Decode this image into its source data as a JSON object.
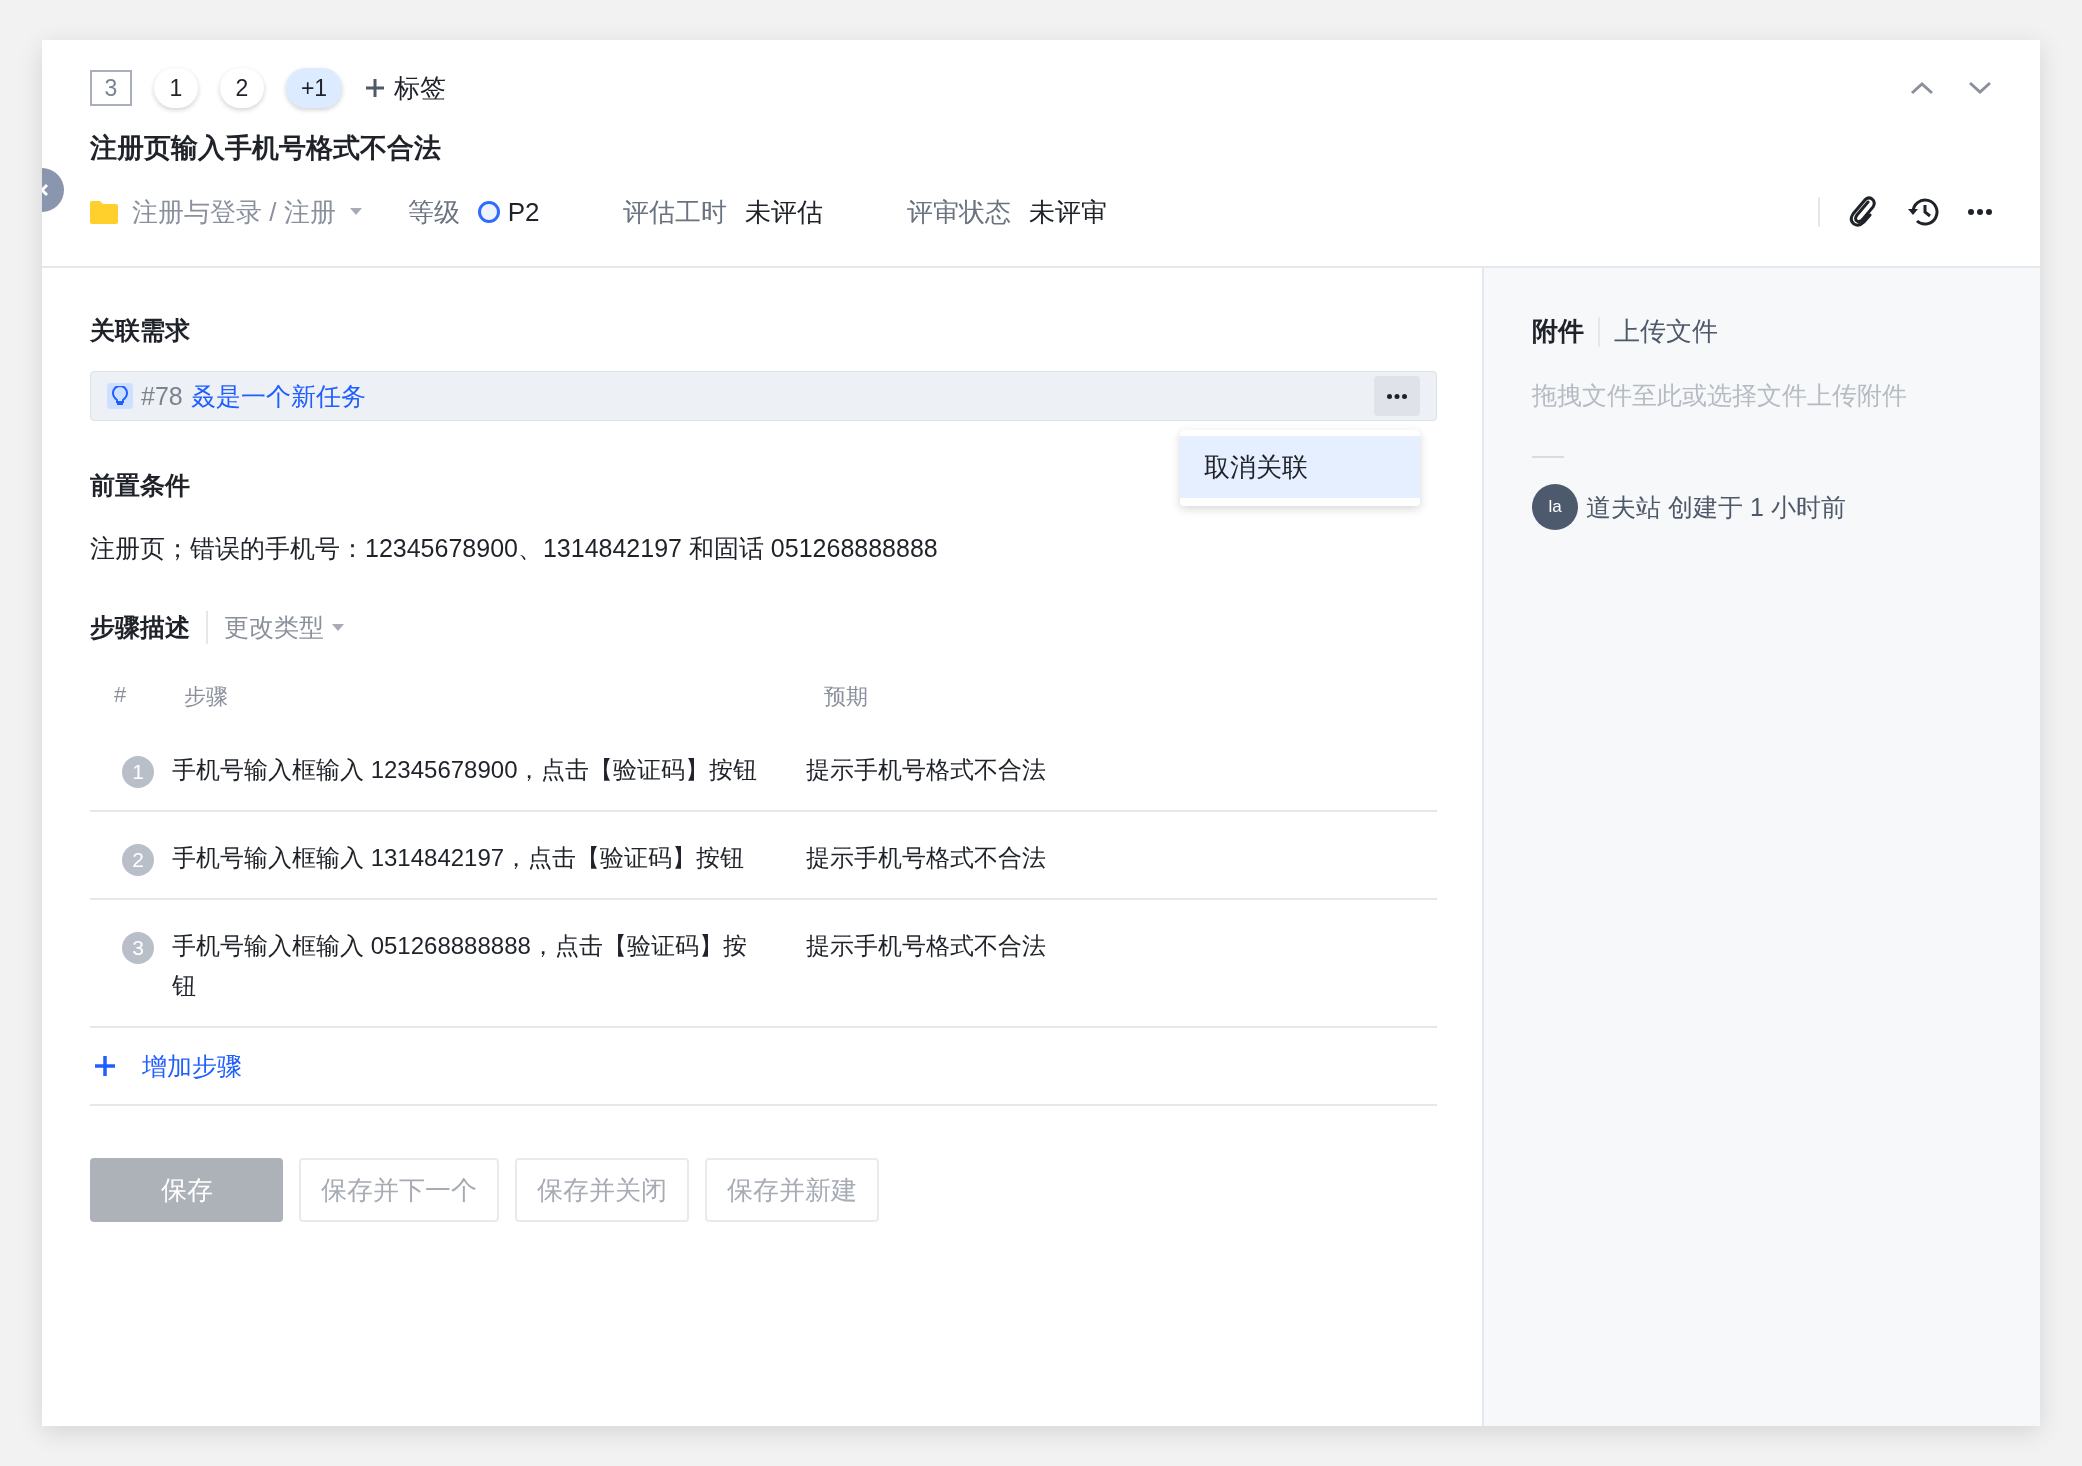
{
  "tag_counter": "3",
  "tags": [
    {
      "label": "1",
      "kind": "number"
    },
    {
      "label": "2",
      "kind": "number"
    },
    {
      "label": "+1",
      "kind": "more"
    }
  ],
  "add_tag": {
    "label": "标签"
  },
  "title": "注册页输入手机号格式不合法",
  "meta": {
    "folder_path": "注册与登录 / 注册",
    "fields": [
      {
        "label": "等级",
        "value": "P2",
        "kind": "priority"
      },
      {
        "label": "评估工时",
        "value": "未评估",
        "kind": "text"
      },
      {
        "label": "评审状态",
        "value": "未评审",
        "kind": "text"
      }
    ]
  },
  "linked_requirement": {
    "heading": "关联需求",
    "id": "#78",
    "name": "叒是一个新任务",
    "menu": [
      {
        "label": "取消关联",
        "selected": true
      }
    ]
  },
  "precondition": {
    "heading": "前置条件",
    "text": "注册页；错误的手机号：12345678900、1314842197 和固话 051268888888"
  },
  "steps": {
    "heading": "步骤描述",
    "change_type": "更改类型",
    "columns": [
      "#",
      "步骤",
      "预期"
    ],
    "rows": [
      {
        "number": "1",
        "step": "手机号输入框输入 12345678900，点击【验证码】按钮",
        "expected": "提示手机号格式不合法"
      },
      {
        "number": "2",
        "step": "手机号输入框输入 1314842197，点击【验证码】按钮",
        "expected": "提示手机号格式不合法"
      },
      {
        "number": "3",
        "step": "手机号输入框输入 051268888888，点击【验证码】按钮",
        "expected": "提示手机号格式不合法"
      }
    ],
    "add_step": "增加步骤"
  },
  "buttons": [
    {
      "label": "保存",
      "kind": "primary",
      "disabled": true
    },
    {
      "label": "保存并下一个",
      "kind": "default",
      "disabled": true
    },
    {
      "label": "保存并关闭",
      "kind": "default",
      "disabled": true
    },
    {
      "label": "保存并新建",
      "kind": "default",
      "disabled": true
    }
  ],
  "side_panel": {
    "tabs": [
      {
        "label": "附件",
        "selected": true
      },
      {
        "label": "上传文件",
        "selected": false
      }
    ],
    "hint": "拖拽文件至此或选择文件上传附件",
    "activity": [
      {
        "avatar": "la",
        "text": "道夫站 创建于 1 小时前"
      }
    ]
  }
}
